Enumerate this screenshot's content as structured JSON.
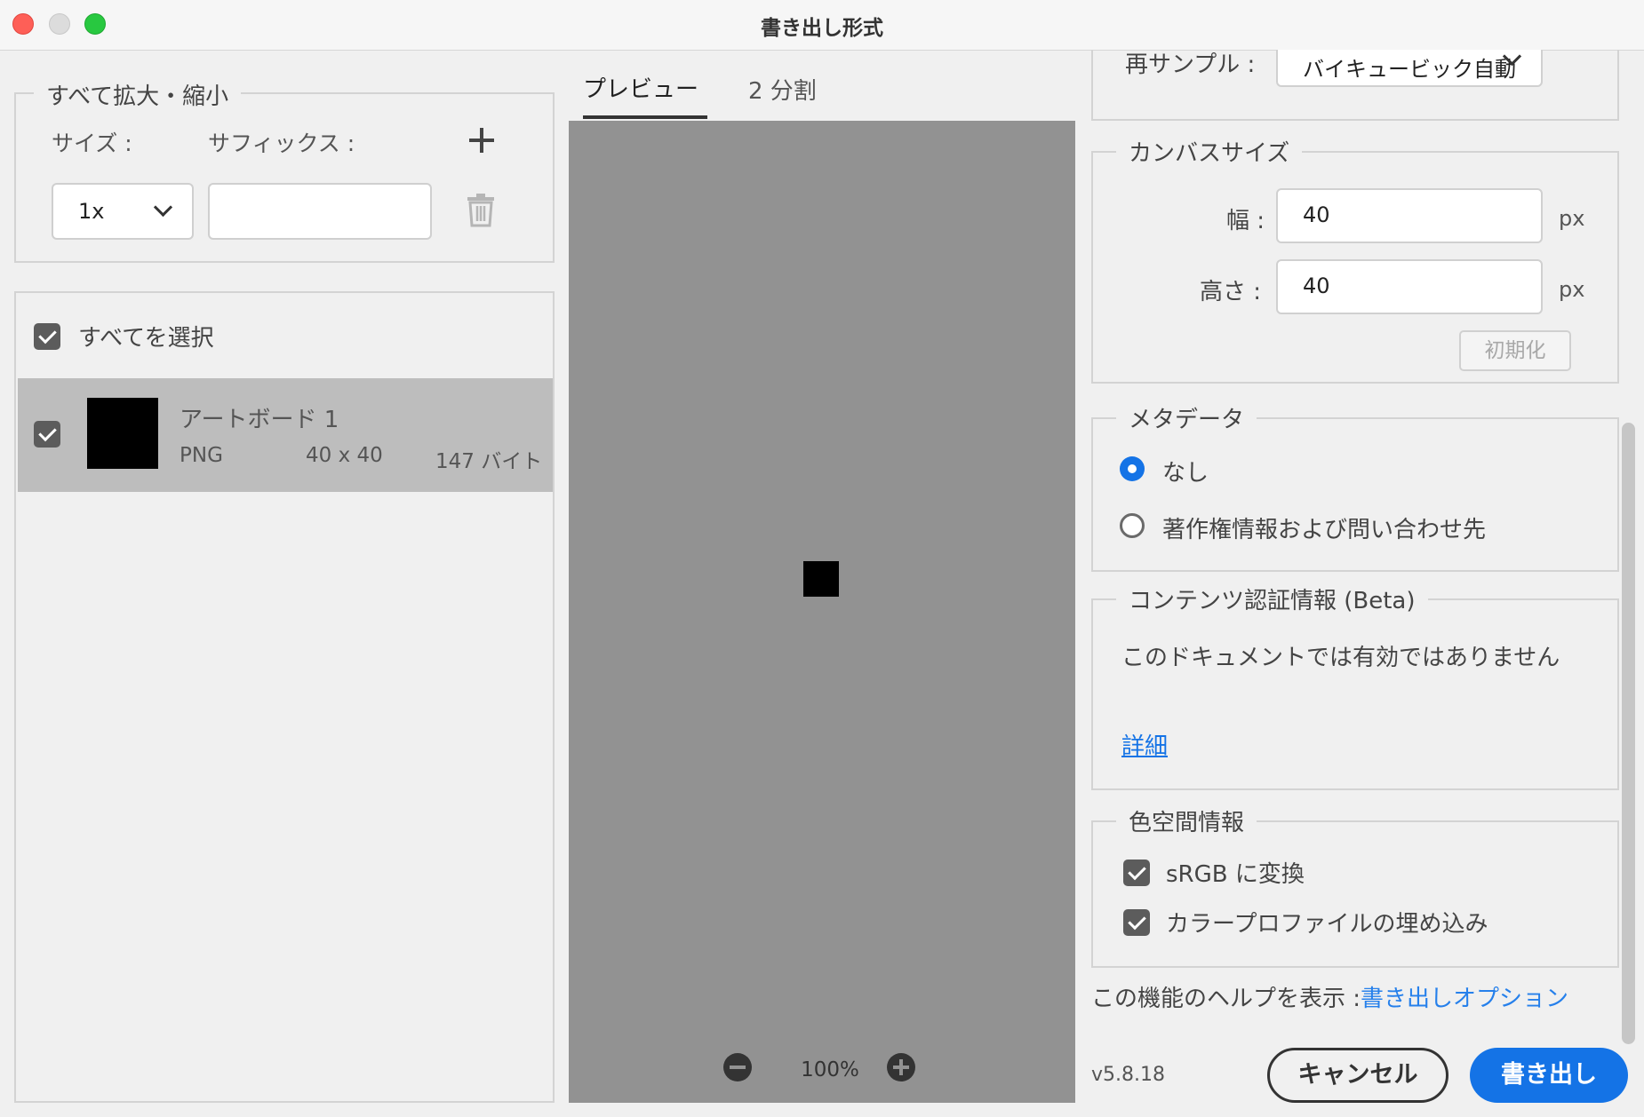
{
  "window": {
    "title": "書き出し形式"
  },
  "scale_section": {
    "legend": "すべて拡大・縮小",
    "size_label": "サイズ :",
    "suffix_label": "サフィックス :",
    "scale_value": "1x",
    "suffix_value": ""
  },
  "assets": {
    "select_all_label": "すべてを選択",
    "items": [
      {
        "name": "アートボード 1",
        "format": "PNG",
        "dimensions": "40 x 40",
        "size": "147 バイト"
      }
    ]
  },
  "preview": {
    "tabs": [
      {
        "label": "プレビュー"
      },
      {
        "label": "2 分割"
      }
    ],
    "zoom": "100%"
  },
  "settings": {
    "resample_label": "再サンプル :",
    "resample_value": "バイキュービック自動",
    "canvas": {
      "legend": "カンバスサイズ",
      "width_label": "幅 :",
      "width_value": "40",
      "height_label": "高さ :",
      "height_value": "40",
      "unit": "px",
      "reset_label": "初期化"
    },
    "metadata": {
      "legend": "メタデータ",
      "options": [
        {
          "label": "なし",
          "selected": true
        },
        {
          "label": "著作権情報および問い合わせ先",
          "selected": false
        }
      ]
    },
    "content_credentials": {
      "legend": "コンテンツ認証情報 (Beta)",
      "message": "このドキュメントでは有効ではありません",
      "details_link": "詳細"
    },
    "color_space": {
      "legend": "色空間情報",
      "options": [
        {
          "label": "sRGB に変換",
          "checked": true
        },
        {
          "label": "カラープロファイルの埋め込み",
          "checked": true
        }
      ]
    },
    "help_text": "この機能のヘルプを表示 :",
    "help_link": "書き出しオプション"
  },
  "footer": {
    "version": "v5.8.18",
    "cancel_label": "キャンセル",
    "export_label": "書き出し"
  },
  "colors": {
    "accent": "#1473e6",
    "preview_bg": "#929292",
    "selected_row": "#bdbdbd"
  }
}
